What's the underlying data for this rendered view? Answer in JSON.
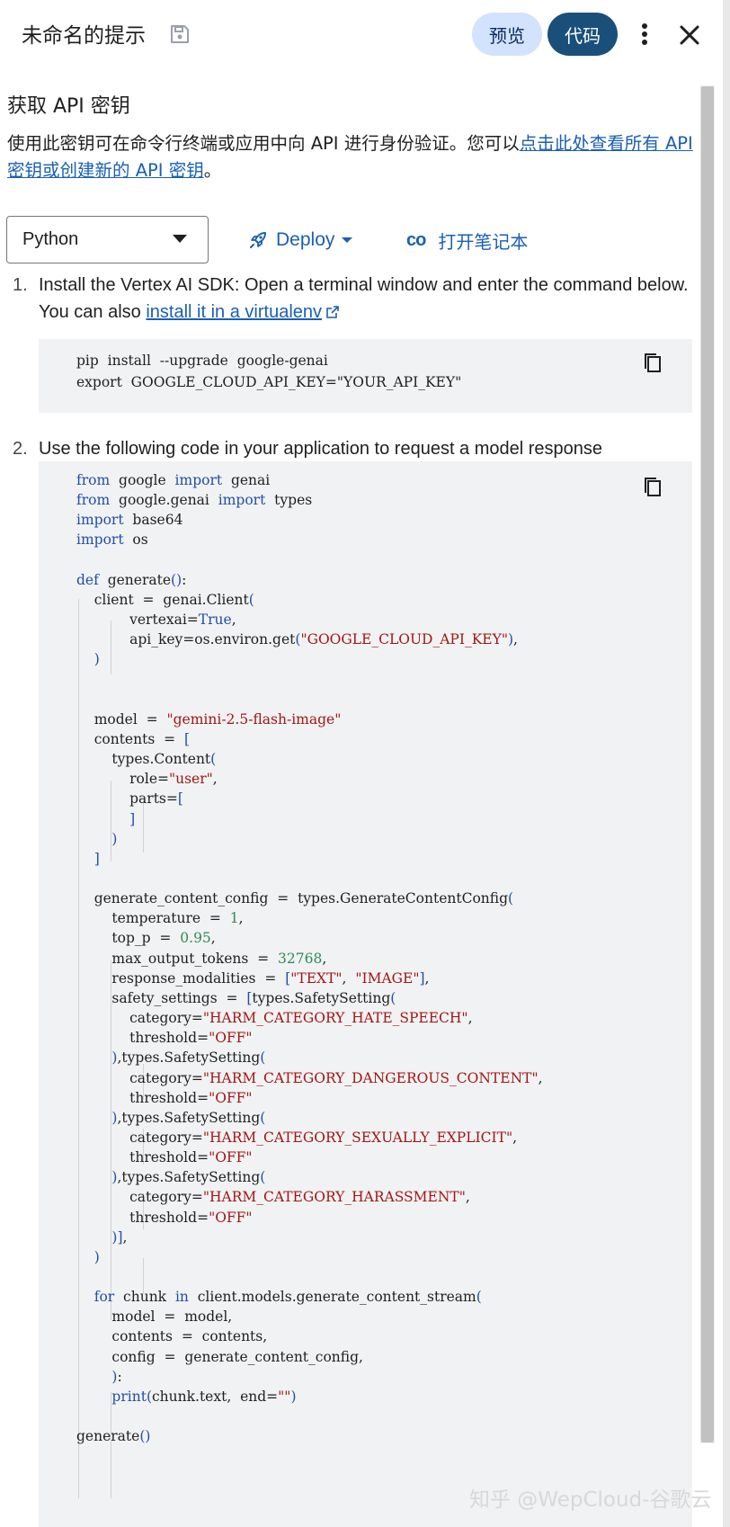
{
  "header": {
    "title": "未命名的提示",
    "preview_label": "预览",
    "code_label": "代码"
  },
  "section": {
    "title": "获取 API 密钥",
    "description_prefix": "使用此密钥可在命令行终端或应用中向 API 进行身份验证。您可以",
    "description_link": "点击此处查看所有 API 密钥或创建新的 API 密钥",
    "description_suffix": "。"
  },
  "toolbar": {
    "language": "Python",
    "deploy_label": "Deploy",
    "notebook_icon_text": "co",
    "notebook_label": "打开笔记本"
  },
  "steps": [
    {
      "number": "1.",
      "text": "Install the Vertex AI SDK: Open a terminal window and enter the command below. You can also ",
      "link": "install it in a virtualenv"
    },
    {
      "number": "2.",
      "text": "Use the following code in your application to request a model response"
    }
  ],
  "install_code": [
    "pip  install  --upgrade  google-genai",
    "export  GOOGLE_CLOUD_API_KEY=\"YOUR_API_KEY\""
  ],
  "code_lines": [
    "from  google  import  genai",
    "from  google.genai  import  types",
    "import  base64",
    "import  os",
    "",
    "def  generate():",
    "    client  =  genai.Client(",
    "            vertexai=True,",
    "            api_key=os.environ.get(\"GOOGLE_CLOUD_API_KEY\"),",
    "    )",
    "",
    "",
    "    model  =  \"gemini-2.5-flash-image\"",
    "    contents  =  [",
    "        types.Content(",
    "            role=\"user\",",
    "            parts=[",
    "            ]",
    "        )",
    "    ]",
    "",
    "    generate_content_config  =  types.GenerateContentConfig(",
    "        temperature  =  1,",
    "        top_p  =  0.95,",
    "        max_output_tokens  =  32768,",
    "        response_modalities  =  [\"TEXT\",  \"IMAGE\"],",
    "        safety_settings  =  [types.SafetySetting(",
    "            category=\"HARM_CATEGORY_HATE_SPEECH\",",
    "            threshold=\"OFF\"",
    "        ),types.SafetySetting(",
    "            category=\"HARM_CATEGORY_DANGEROUS_CONTENT\",",
    "            threshold=\"OFF\"",
    "        ),types.SafetySetting(",
    "            category=\"HARM_CATEGORY_SEXUALLY_EXPLICIT\",",
    "            threshold=\"OFF\"",
    "        ),types.SafetySetting(",
    "            category=\"HARM_CATEGORY_HARASSMENT\",",
    "            threshold=\"OFF\"",
    "        )],",
    "    )",
    "",
    "    for  chunk  in  client.models.generate_content_stream(",
    "        model  =  model,",
    "        contents  =  contents,",
    "        config  =  generate_content_config,",
    "        ):",
    "        print(chunk.text,  end=\"\")",
    "",
    "generate()"
  ],
  "watermark": "知乎 @WepCloud-谷歌云",
  "colors": {
    "link": "#1a5fb4",
    "keyword": "#1f4fa8",
    "string": "#a31515",
    "number": "#2e8b57",
    "code_bg": "#f1f2f3",
    "preview_bg": "#d3e3fd",
    "code_btn_bg": "#1a4f7a"
  },
  "icons": {
    "save": "save-icon",
    "more": "more-vert-icon",
    "close": "close-icon",
    "rocket": "rocket-icon",
    "copy": "copy-icon",
    "external": "external-link-icon"
  }
}
